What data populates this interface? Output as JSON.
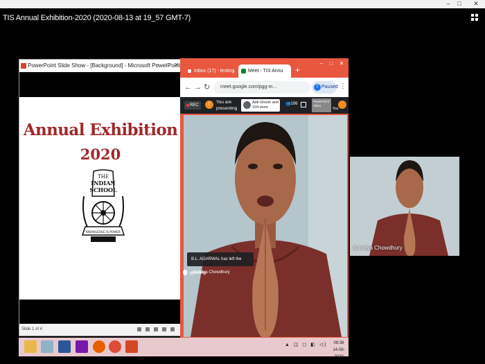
{
  "video": {
    "title": "TIS Annual Exhibition-2020 (2020-08-13 at 19_57 GMT-7)"
  },
  "top_strip": {
    "minimize": "–",
    "maximize": "□",
    "close": "✕"
  },
  "ppt": {
    "window_title": "PowerPoint Slide Show - [Background] - Microsoft PowerPoint ...",
    "slide_heading": "Annual Exhibition",
    "slide_year": "2020",
    "status_text": "Slide 1 of 4",
    "seal": {
      "line1": "THE",
      "line2": "INDIAN",
      "line3": "SCHOOL",
      "motto": "KNOWLEDGE IS POWER"
    }
  },
  "chrome": {
    "tabs": [
      {
        "label": "Inbox (17) - testing"
      },
      {
        "label": "Meet - TIS Annu"
      }
    ],
    "new_tab": "+",
    "url": "meet.google.com/pgg-m...",
    "profile_initial": "T",
    "profile_label": "Paused",
    "window_controls": {
      "minimize": "–",
      "maximize": "□",
      "close": "✕"
    }
  },
  "meet": {
    "rec_label": "REC",
    "presenter_initial": "T",
    "presenting_text": "You are presenting",
    "joined_text": "Adit Ghosh and 104 more",
    "people_count": "106",
    "present_thumb_text": "PowerPoint Vibes",
    "you_label": "You",
    "left_notice": "B.L. AGARWAL has left the meeting",
    "speaker_name": "Anindya Chowdhury",
    "thumb_name": "Anindya Chowdhury"
  },
  "taskbar": {
    "apps": [
      {
        "name": "file-explorer",
        "color": "#e8b84a"
      },
      {
        "name": "notepad",
        "color": "#8fb3c9"
      },
      {
        "name": "word",
        "color": "#2b579a"
      },
      {
        "name": "onenote",
        "color": "#7719aa"
      },
      {
        "name": "firefox",
        "color": "#e66000"
      },
      {
        "name": "chrome",
        "color": "#dd4b39"
      },
      {
        "name": "powerpoint",
        "color": "#d24726"
      }
    ],
    "tray_icons": "▲ ◫ ◻ ◧ ◁)",
    "time": "08:38",
    "date": "14-08-2020"
  },
  "colors": {
    "chrome_accent": "#e9573f",
    "slide_red": "#a0282a",
    "taskbar_bg": "#e8c9cd"
  }
}
